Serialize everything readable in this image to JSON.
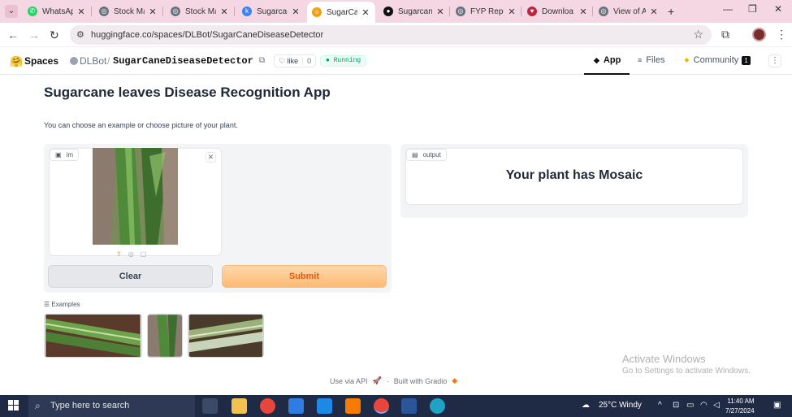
{
  "browser": {
    "tabs": [
      {
        "title": "WhatsApp",
        "icon": "whatsapp-icon",
        "color": "#25d366"
      },
      {
        "title": "Stock Ma",
        "icon": "globe-icon",
        "color": "#555555"
      },
      {
        "title": "Stock Ma",
        "icon": "globe-icon",
        "color": "#555555"
      },
      {
        "title": "Sugarcane",
        "icon": "k-icon",
        "color": "#3b82f6"
      },
      {
        "title": "SugarCan",
        "icon": "huggingface-icon",
        "color": "#f59e0b"
      },
      {
        "title": "Sugarcan",
        "icon": "github-icon",
        "color": "#111111"
      },
      {
        "title": "FYP Repo",
        "icon": "globe-icon",
        "color": "#555555"
      },
      {
        "title": "Downloa",
        "icon": "heart-icon",
        "color": "#c0263a"
      },
      {
        "title": "View of A",
        "icon": "globe-icon",
        "color": "#555555"
      }
    ],
    "active_tab_index": 4,
    "url": "huggingface.co/spaces/DLBot/SugarCaneDiseaseDetector"
  },
  "hf": {
    "spaces_label": "Spaces",
    "owner": "DLBot",
    "separator": "/",
    "repo": "SugarCaneDiseaseDetector",
    "like_label": "like",
    "like_count": "0",
    "status": "Running",
    "tabs": {
      "app": "App",
      "files": "Files",
      "community": "Community",
      "community_count": "1"
    }
  },
  "app": {
    "title": "Sugarcane leaves Disease Recognition App",
    "description": "You can choose an example or choose picture of your plant.",
    "input_label": "im",
    "output_label": "output",
    "output_text": "Your plant has Mosaic",
    "clear_label": "Clear",
    "submit_label": "Submit",
    "examples_label": "Examples"
  },
  "footer": {
    "api": "Use via API",
    "separator": "·",
    "built": "Built with Gradio"
  },
  "watermark": {
    "line1": "Activate Windows",
    "line2": "Go to Settings to activate Windows."
  },
  "taskbar": {
    "search_placeholder": "Type here to search",
    "weather": "25°C  Windy",
    "time": "11:40 AM",
    "date": "7/27/2024"
  }
}
